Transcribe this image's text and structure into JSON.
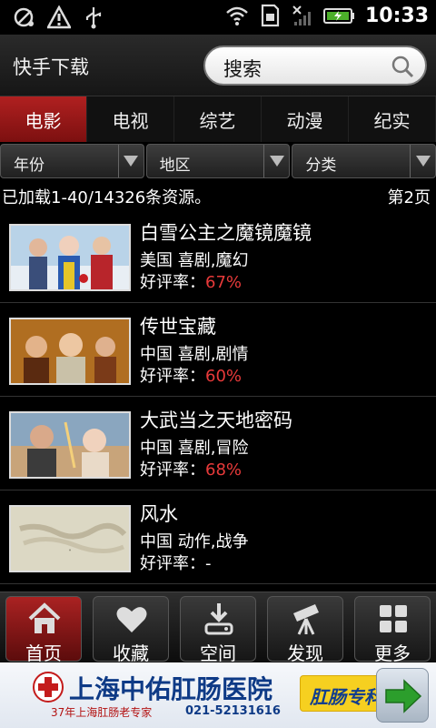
{
  "status_bar": {
    "time": "10:33",
    "icons": [
      "usb-debug-icon",
      "warning-icon",
      "usb-icon",
      "wifi-icon",
      "sim-card-icon",
      "no-signal-icon",
      "battery-icon"
    ]
  },
  "header": {
    "title": "快手下载",
    "search_label": "搜索",
    "search_icon": "search-icon"
  },
  "tabs": [
    {
      "label": "电影",
      "active": true
    },
    {
      "label": "电视",
      "active": false
    },
    {
      "label": "综艺",
      "active": false
    },
    {
      "label": "动漫",
      "active": false
    },
    {
      "label": "纪实",
      "active": false
    }
  ],
  "filters": [
    {
      "label": "年份"
    },
    {
      "label": "地区"
    },
    {
      "label": "分类"
    }
  ],
  "info": {
    "loaded_text": "已加载1-40/14326条资源。",
    "page_text": "第2页"
  },
  "list": [
    {
      "title": "白雪公主之魔镜魔镜",
      "meta": "美国 喜剧,魔幻",
      "rate_label": "好评率：",
      "rate": "67%"
    },
    {
      "title": "传世宝藏",
      "meta": "中国 喜剧,剧情",
      "rate_label": "好评率：",
      "rate": "60%"
    },
    {
      "title": "大武当之天地密码",
      "meta": "中国 喜剧,冒险",
      "rate_label": "好评率：",
      "rate": "68%"
    },
    {
      "title": "风水",
      "meta": "中国 动作,战争",
      "rate_label": "好评率：",
      "rate": "-"
    }
  ],
  "bottom_nav": [
    {
      "label": "首页",
      "icon": "home-icon",
      "active": true
    },
    {
      "label": "收藏",
      "icon": "heart-icon",
      "active": false
    },
    {
      "label": "空间",
      "icon": "download-icon",
      "active": false
    },
    {
      "label": "发现",
      "icon": "telescope-icon",
      "active": false
    },
    {
      "label": "更多",
      "icon": "grid-icon",
      "active": false
    }
  ],
  "ad": {
    "title": "上海中佑肛肠医院",
    "subtitle": "37年上海肛肠老专家",
    "phone": "021-52131616",
    "tag": "肛肠专科",
    "colors": {
      "title": "#0e3a86",
      "tag_bg": "#f6d020",
      "arrow": "#2c9e2c"
    }
  },
  "colors": {
    "accent": "#a22222",
    "rating": "#e83a3a"
  }
}
